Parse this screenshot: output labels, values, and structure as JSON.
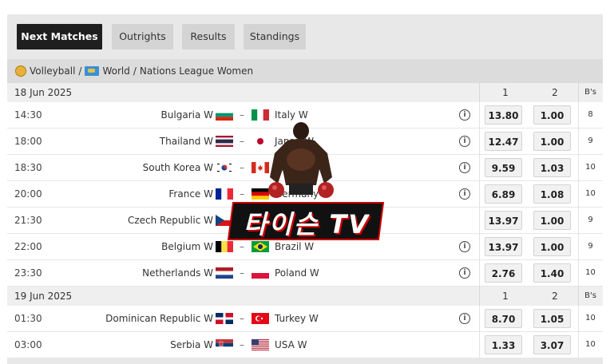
{
  "tabs": [
    {
      "label": "Next Matches",
      "active": true
    },
    {
      "label": "Outrights",
      "active": false
    },
    {
      "label": "Results",
      "active": false
    },
    {
      "label": "Standings",
      "active": false
    }
  ],
  "breadcrumb": {
    "sport": "Volleyball",
    "sep1": "/",
    "region": "World",
    "sep2": "/",
    "league": "Nations League Women"
  },
  "columns": {
    "c1": "1",
    "c2": "2",
    "bs": "B's"
  },
  "days": [
    {
      "date": "18 Jun 2025",
      "matches": [
        {
          "time": "14:30",
          "home": "Bulgaria W",
          "home_flag": "bulgaria",
          "away": "Italy W",
          "away_flag": "italy",
          "info": true,
          "odd1": "13.80",
          "odd2": "1.00",
          "bs": "8"
        },
        {
          "time": "18:00",
          "home": "Thailand W",
          "home_flag": "thailand",
          "away": "Japan W",
          "away_flag": "japan",
          "info": true,
          "odd1": "12.47",
          "odd2": "1.00",
          "bs": "9"
        },
        {
          "time": "18:30",
          "home": "South Korea W",
          "home_flag": "south-korea",
          "away": "Canada W",
          "away_flag": "canada",
          "info": true,
          "odd1": "9.59",
          "odd2": "1.03",
          "bs": "10"
        },
        {
          "time": "20:00",
          "home": "France W",
          "home_flag": "france",
          "away": "Germany W",
          "away_flag": "germany",
          "info": true,
          "odd1": "6.89",
          "odd2": "1.08",
          "bs": "10"
        },
        {
          "time": "21:30",
          "home": "Czech Republic W",
          "home_flag": "czech",
          "away": "",
          "away_flag": "",
          "info": false,
          "odd1": "13.97",
          "odd2": "1.00",
          "bs": "9"
        },
        {
          "time": "22:00",
          "home": "Belgium W",
          "home_flag": "belgium",
          "away": "Brazil W",
          "away_flag": "brazil",
          "info": true,
          "odd1": "13.97",
          "odd2": "1.00",
          "bs": "9"
        },
        {
          "time": "23:30",
          "home": "Netherlands W",
          "home_flag": "netherlands",
          "away": "Poland W",
          "away_flag": "poland",
          "info": true,
          "odd1": "2.76",
          "odd2": "1.40",
          "bs": "10"
        }
      ]
    },
    {
      "date": "19 Jun 2025",
      "matches": [
        {
          "time": "01:30",
          "home": "Dominican Republic W",
          "home_flag": "dominican",
          "away": "Turkey W",
          "away_flag": "turkey",
          "info": true,
          "odd1": "8.70",
          "odd2": "1.05",
          "bs": "10"
        },
        {
          "time": "03:00",
          "home": "Serbia W",
          "home_flag": "serbia",
          "away": "USA W",
          "away_flag": "usa",
          "info": false,
          "odd1": "1.33",
          "odd2": "3.07",
          "bs": "10"
        }
      ]
    }
  ],
  "overlay": {
    "text": "타이슨 TV"
  },
  "icons": {
    "info": "info-icon",
    "sport": "volleyball-icon",
    "region": "world-map-icon"
  }
}
